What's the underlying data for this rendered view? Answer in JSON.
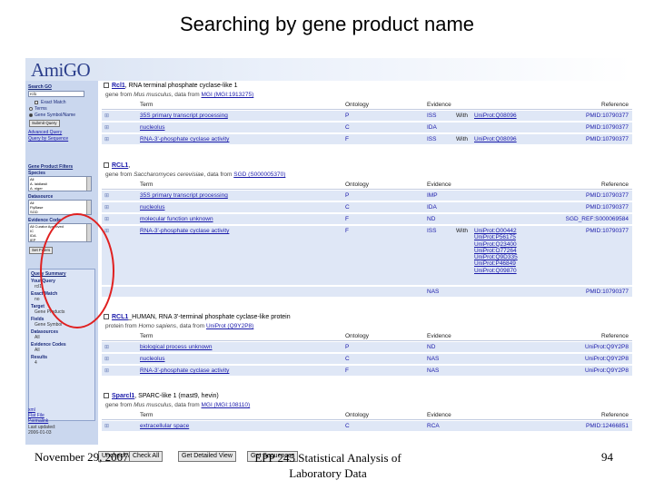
{
  "slide": {
    "title": "Searching by gene product name",
    "footer_date": "November 29, 2007",
    "footer_course_line1": "EPP 245 Statistical Analysis of",
    "footer_course_line2": "Laboratory Data",
    "page_number": "94"
  },
  "app": {
    "logo": "AmiGO"
  },
  "sidebar": {
    "search_heading": "Search GO",
    "search_value": "rcl1",
    "exact_match": "Exact Match",
    "opt_terms": "Terms",
    "opt_gene": "Gene Symbol/Name",
    "submit": "Submit Query",
    "advanced": "Advanced Query",
    "by_sequence": "Query by Sequence",
    "filter_heading": "Gene Product Filters",
    "species_label": "Species",
    "species_options": [
      "All",
      "A. laidlawii",
      "A. niger"
    ],
    "datasource_label": "Datasource",
    "datasource_options": [
      "All",
      "FlyBase",
      "SGD"
    ],
    "evidence_label": "Evidence Code",
    "evidence_options": [
      "All Curator Approved",
      "IC",
      "IDA",
      "IEP"
    ],
    "set_filters": "Set Filters",
    "summary_heading": "Query Summary",
    "summary": [
      {
        "k": "Your Query",
        "v": "rcl1"
      },
      {
        "k": "Exact Match",
        "v": "no"
      },
      {
        "k": "Target",
        "v": "Gene Products"
      },
      {
        "k": "Fields",
        "v": "Gene Symbol"
      },
      {
        "k": "Datasources",
        "v": "All"
      },
      {
        "k": "Evidence Codes",
        "v": "All"
      },
      {
        "k": "Results",
        "v": "4"
      }
    ],
    "links": [
      "xml",
      "Flat File",
      "Permalink"
    ],
    "last_updated_label": "Last updated:",
    "last_updated": "2006-01-03"
  },
  "blocks": [
    {
      "symbol": "Rcl1",
      "title_rest": ", RNA terminal phosphate cyclase-like 1",
      "sub_prefix": "gene from ",
      "sub_species": "Mus musculus",
      "sub_mid": ", data from ",
      "sub_link": "MGI (MGI:1913275)",
      "headers": {
        "term": "Term",
        "ontology": "Ontology",
        "evidence": "Evidence",
        "reference": "Reference"
      },
      "rows": [
        {
          "term": "35S primary transcript processing",
          "ont": "P",
          "evi": "ISS",
          "with_label": "With",
          "with": [
            "UniProt:Q08096"
          ],
          "ref": "PMID:10790377"
        },
        {
          "term": "nucleolus",
          "ont": "C",
          "evi": "IDA",
          "with_label": "",
          "with": [],
          "ref": "PMID:10790377"
        },
        {
          "term": "RNA-3'-phosphate cyclase activity",
          "ont": "F",
          "evi": "ISS",
          "with_label": "With",
          "with": [
            "UniProt:Q08096"
          ],
          "ref": "PMID:10790377"
        }
      ]
    },
    {
      "symbol": "RCL1",
      "title_rest": ",",
      "sub_prefix": "gene from ",
      "sub_species": "Saccharomyces cerevisiae",
      "sub_mid": ", data from ",
      "sub_link": "SGD (S000005370)",
      "headers": {
        "term": "Term",
        "ontology": "Ontology",
        "evidence": "Evidence",
        "reference": "Reference"
      },
      "rows": [
        {
          "term": "35S primary transcript processing",
          "ont": "P",
          "evi": "IMP",
          "with_label": "",
          "with": [],
          "ref": "PMID:10790377"
        },
        {
          "term": "nucleolus",
          "ont": "C",
          "evi": "IDA",
          "with_label": "",
          "with": [],
          "ref": "PMID:10790377"
        },
        {
          "term": "molecular function unknown",
          "ont": "F",
          "evi": "ND",
          "with_label": "",
          "with": [],
          "ref": "SGD_REF:S000069584"
        },
        {
          "term": "RNA-3'-phosphate cyclase activity",
          "ont": "F",
          "evi": "ISS",
          "with_label": "With",
          "with": [
            "UniProt:O00442",
            "UniProt:P56175",
            "UniProt:Q23400",
            "UniProt:O77264",
            "UniProt:Q9D335",
            "UniProt:P46849",
            "UniProt:Q09870"
          ],
          "ref": "PMID:10790377"
        },
        {
          "term": "",
          "ont": "",
          "evi": "NAS",
          "with_label": "",
          "with": [],
          "ref": "PMID:10790377"
        }
      ]
    },
    {
      "symbol": "RCL1",
      "title_rest": "_HUMAN, RNA 3'-terminal phosphate cyclase-like protein",
      "sub_prefix": "protein from ",
      "sub_species": "Homo sapiens",
      "sub_mid": ", data from ",
      "sub_link": "UniProt (Q9Y2P8)",
      "headers": {
        "term": "Term",
        "ontology": "Ontology",
        "evidence": "Evidence",
        "reference": "Reference"
      },
      "rows": [
        {
          "term": "biological process unknown",
          "ont": "P",
          "evi": "ND",
          "with_label": "",
          "with": [],
          "ref": "UniProt:Q9Y2P8"
        },
        {
          "term": "nucleolus",
          "ont": "C",
          "evi": "NAS",
          "with_label": "",
          "with": [],
          "ref": "UniProt:Q9Y2P8"
        },
        {
          "term": "RNA-3'-phosphate cyclase activity",
          "ont": "F",
          "evi": "NAS",
          "with_label": "",
          "with": [],
          "ref": "UniProt:Q9Y2P8"
        }
      ]
    },
    {
      "symbol": "Sparcl1",
      "title_rest": ", SPARC-like 1 (mast9, hevin)",
      "sub_prefix": "gene from ",
      "sub_species": "Mus musculus",
      "sub_mid": ", data from ",
      "sub_link": "MGI (MGI:108110)",
      "headers": {
        "term": "Term",
        "ontology": "Ontology",
        "evidence": "Evidence",
        "reference": "Reference"
      },
      "rows": [
        {
          "term": "extracellular space",
          "ont": "C",
          "evi": "RCA",
          "with_label": "",
          "with": [],
          "ref": "PMID:12466851"
        }
      ]
    }
  ],
  "bottom": {
    "btn1": "Uncheck All",
    "btn2": "Check All",
    "btn3": "Get Detailed View",
    "btn4": "Get Sequences"
  }
}
